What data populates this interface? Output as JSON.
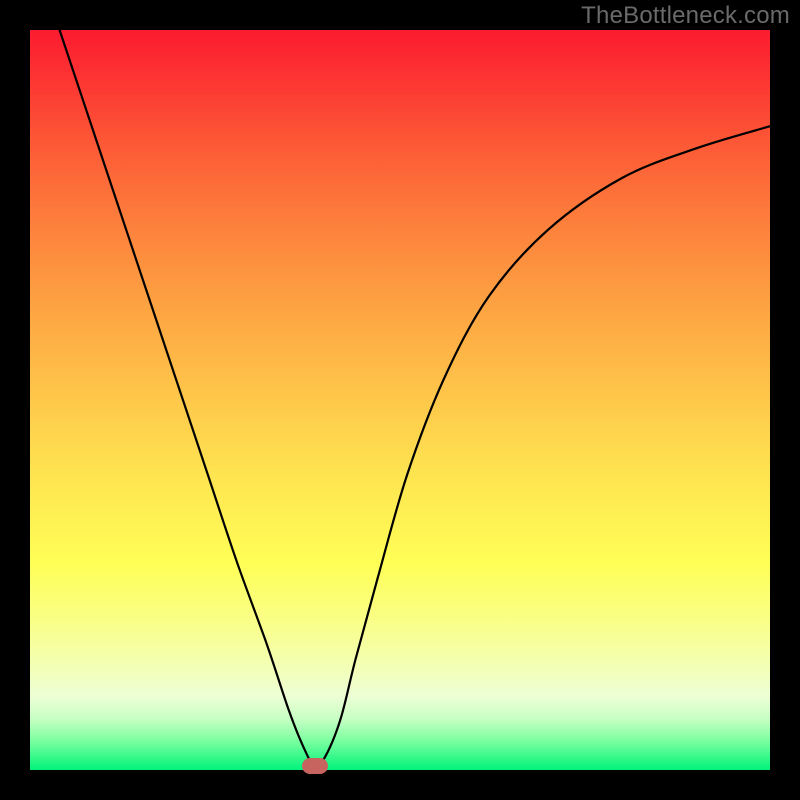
{
  "watermark": "TheBottleneck.com",
  "chart_data": {
    "type": "line",
    "title": "",
    "xlabel": "",
    "ylabel": "",
    "xlim": [
      0,
      100
    ],
    "ylim": [
      0,
      100
    ],
    "grid": false,
    "legend": false,
    "series": [
      {
        "name": "curve",
        "color": "#000000",
        "x": [
          4,
          8,
          12,
          16,
          20,
          24,
          28,
          32,
          35,
          37,
          38.5,
          40,
          42,
          44,
          47,
          51,
          56,
          62,
          70,
          80,
          90,
          100
        ],
        "y": [
          100,
          88,
          76,
          64,
          52,
          40,
          28,
          17,
          8,
          3,
          0.5,
          2,
          7,
          15,
          26,
          40,
          53,
          64,
          73,
          80,
          84,
          87
        ]
      }
    ],
    "background_gradient": [
      "#fc1b2f",
      "#fee450",
      "#ffff56",
      "#00f37a"
    ],
    "marker": {
      "x": 38.5,
      "y": 0.5,
      "color": "#c86460"
    }
  }
}
